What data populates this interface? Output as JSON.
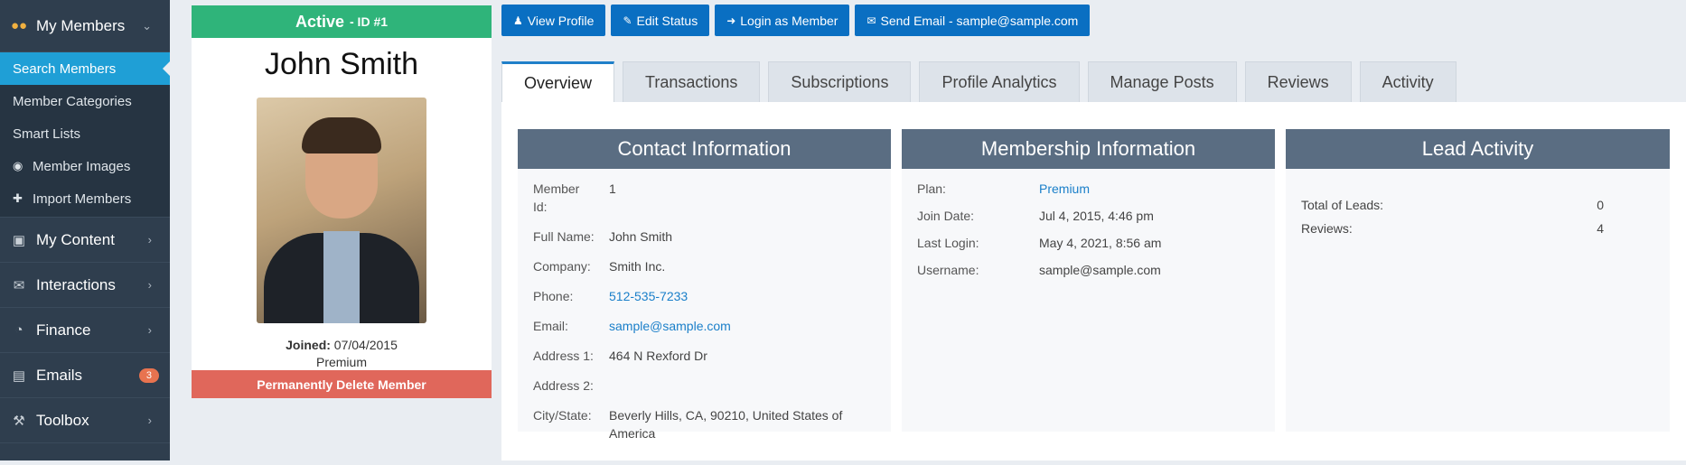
{
  "sidebar": {
    "top": {
      "label": "My Members"
    },
    "subitems": [
      {
        "label": "Search Members",
        "active": true
      },
      {
        "label": "Member Categories"
      },
      {
        "label": "Smart Lists"
      },
      {
        "label": "Member Images"
      },
      {
        "label": "Import Members"
      }
    ],
    "sections": [
      {
        "label": "My Content"
      },
      {
        "label": "Interactions"
      },
      {
        "label": "Finance"
      },
      {
        "label": "Emails",
        "badge": "3"
      },
      {
        "label": "Toolbox"
      }
    ]
  },
  "profile": {
    "status": "Active",
    "id_label": "- ID #1",
    "name": "John Smith",
    "joined_label": "Joined:",
    "joined_date": "07/04/2015",
    "plan": "Premium",
    "delete_label": "Permanently Delete Member"
  },
  "actions": {
    "view_profile": "View Profile",
    "edit_status": "Edit Status",
    "login_as": "Login as Member",
    "send_email": "Send Email - sample@sample.com"
  },
  "tabs": [
    "Overview",
    "Transactions",
    "Subscriptions",
    "Profile Analytics",
    "Manage Posts",
    "Reviews",
    "Activity"
  ],
  "contact": {
    "title": "Contact Information",
    "rows": [
      {
        "k": "Member Id:",
        "v": "1"
      },
      {
        "k": "Full Name:",
        "v": "John Smith"
      },
      {
        "k": "Company:",
        "v": "Smith Inc."
      },
      {
        "k": "Phone:",
        "v": "512-535-7233"
      },
      {
        "k": "Email:",
        "v": "sample@sample.com"
      },
      {
        "k": "Address 1:",
        "v": "464 N Rexford Dr"
      },
      {
        "k": "Address 2:",
        "v": ""
      },
      {
        "k": "City/State:",
        "v": "Beverly Hills, CA, 90210, United States of America"
      }
    ]
  },
  "membership": {
    "title": "Membership Information",
    "rows": [
      {
        "k": "Plan:",
        "v": "Premium"
      },
      {
        "k": "Join Date:",
        "v": "Jul 4, 2015, 4:46 pm"
      },
      {
        "k": "Last Login:",
        "v": "May 4, 2021, 8:56 am"
      },
      {
        "k": "Username:",
        "v": "sample@sample.com"
      }
    ]
  },
  "lead": {
    "title": "Lead Activity",
    "rows": [
      {
        "k": "Total of Leads:",
        "v": "0"
      },
      {
        "k": "Reviews:",
        "v": "4"
      }
    ]
  },
  "colors": {
    "accent": "#1f9fd6",
    "status": "#2fb47a",
    "danger": "#e0675b",
    "button": "#0a6fc2"
  }
}
